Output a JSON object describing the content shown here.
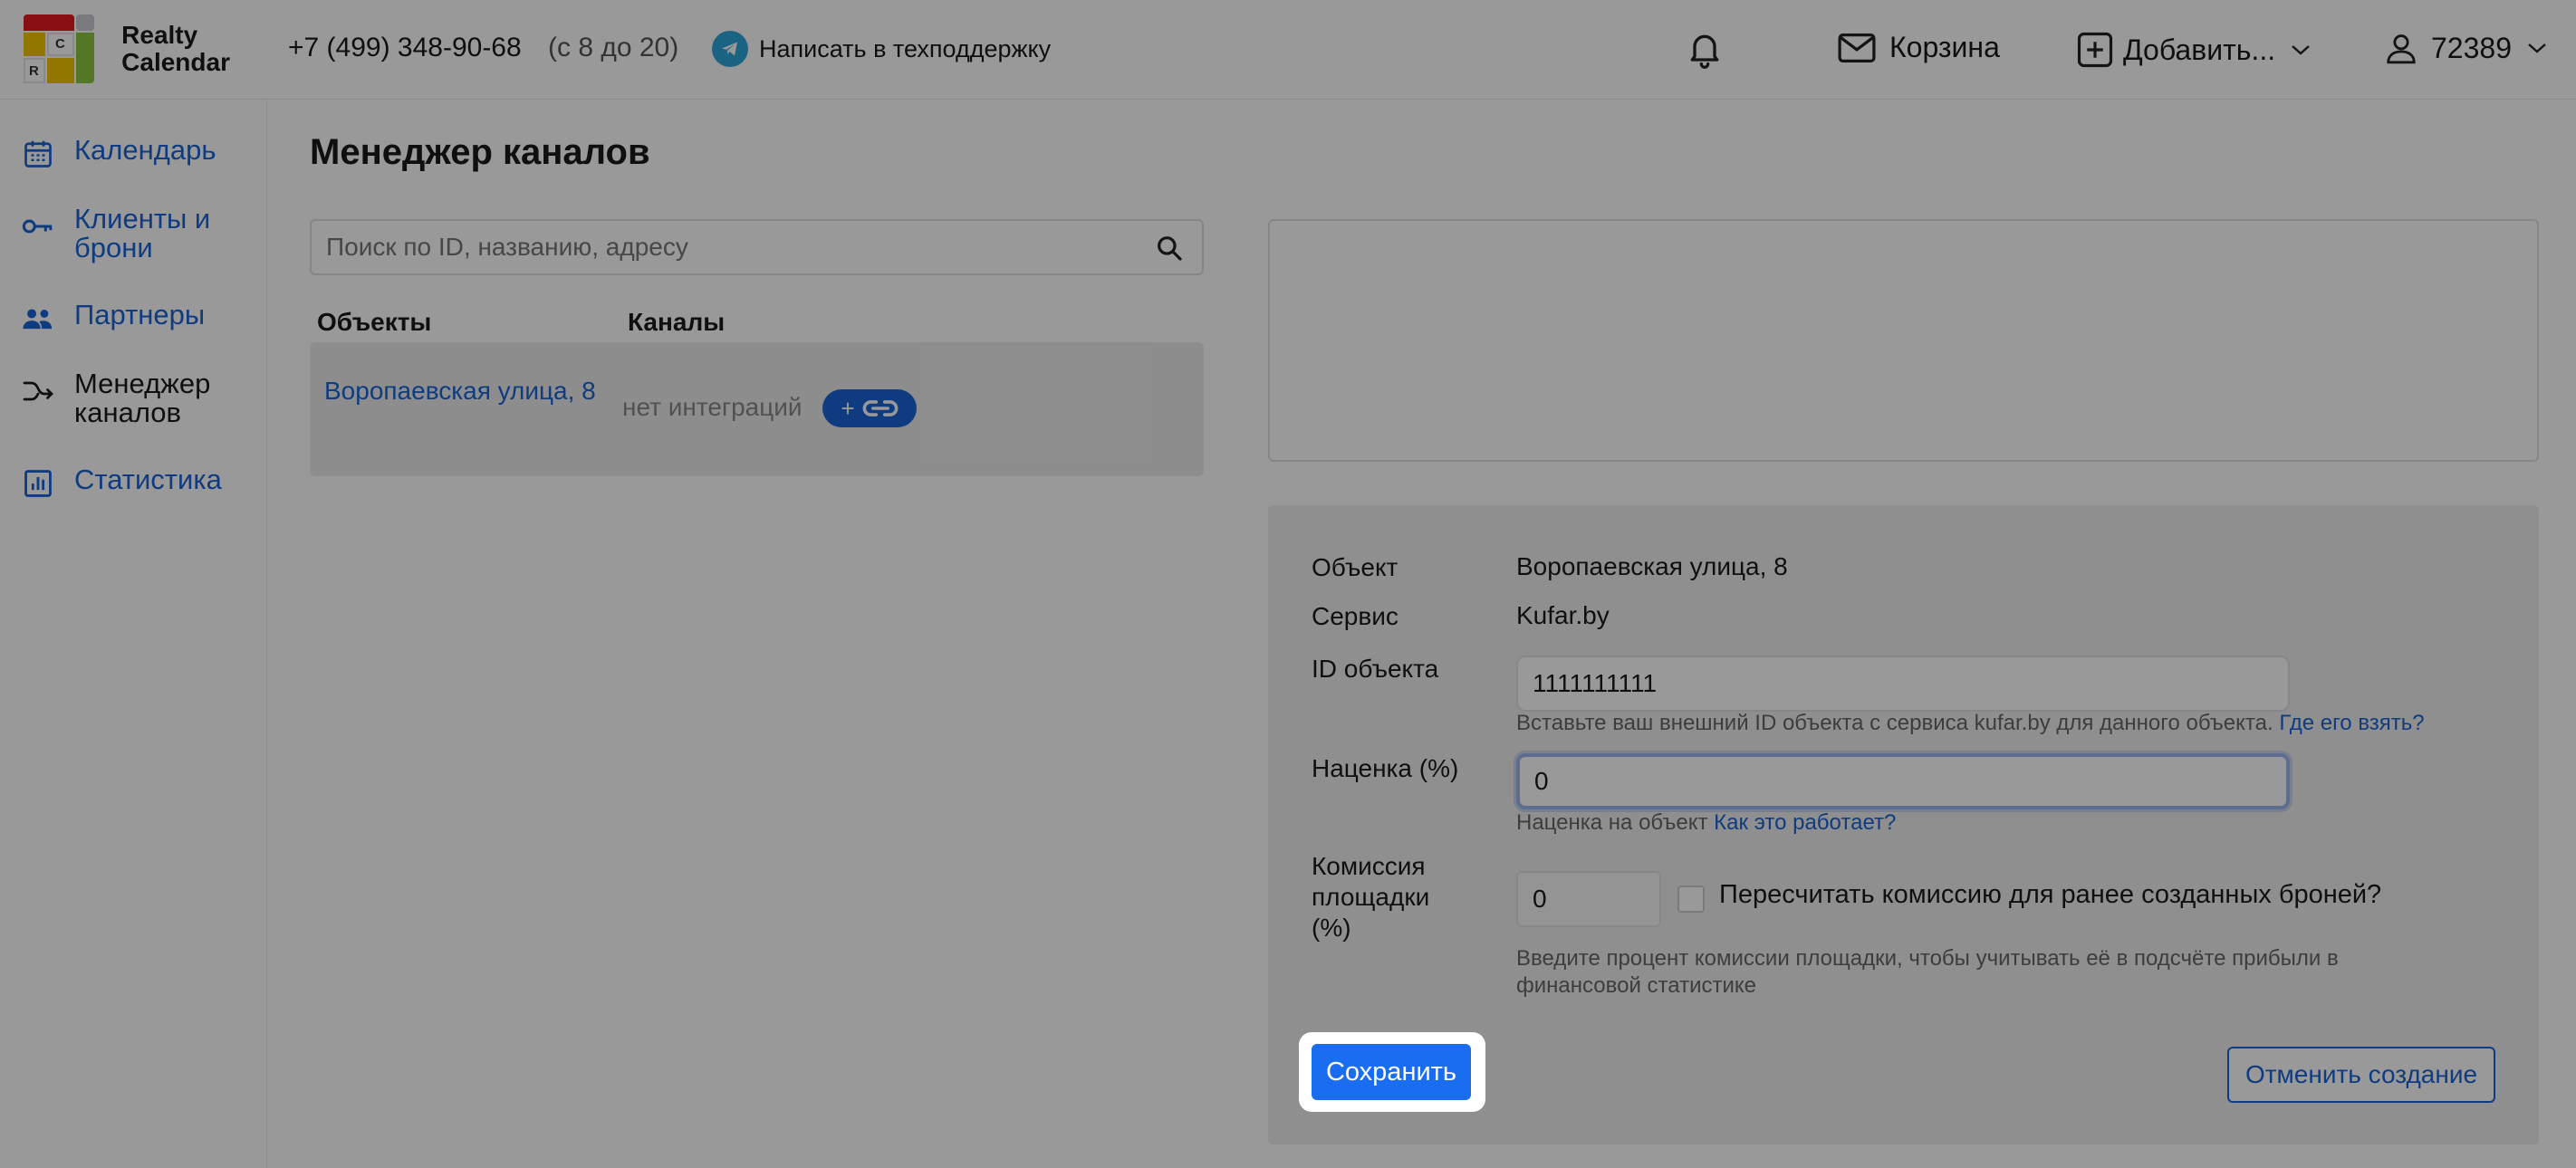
{
  "header": {
    "logo_text": "Realty Calendar",
    "logo_letters": {
      "c": "C",
      "r": "R"
    },
    "phone": "+7 (499) 348-90-68",
    "hours": "(с 8 до 20)",
    "support_label": "Написать в техподдержку",
    "cart_label": "Корзина",
    "add_label": "Добавить...",
    "user_id": "72389"
  },
  "sidebar": {
    "items": [
      {
        "label": "Календарь",
        "icon": "calendar-icon",
        "active": false
      },
      {
        "label": "Клиенты и брони",
        "icon": "key-icon",
        "active": false
      },
      {
        "label": "Партнеры",
        "icon": "people-icon",
        "active": false
      },
      {
        "label": "Менеджер каналов",
        "icon": "channels-icon",
        "active": true
      },
      {
        "label": "Статистика",
        "icon": "chart-icon",
        "active": false
      }
    ]
  },
  "main": {
    "title": "Менеджер каналов",
    "search_placeholder": "Поиск по ID, названию, адресу",
    "table_headers": {
      "objects": "Объекты",
      "channels": "Каналы"
    },
    "rows": [
      {
        "object": "Воропаевская улица, 8",
        "channels": "нет интеграций",
        "link_btn": "+"
      }
    ]
  },
  "form": {
    "object_label": "Объект",
    "object_value": "Воропаевская улица, 8",
    "service_label": "Сервис",
    "service_value": "Kufar.by",
    "id_label": "ID объекта",
    "id_value": "1111111111",
    "id_help": "Вставьте ваш внешний ID объекта с сервиса kufar.by для данного объекта.",
    "id_help_link": "Где его взять?",
    "markup_label": "Наценка (%)",
    "markup_value": "0",
    "markup_help": "Наценка на объект",
    "markup_help_link": "Как это работает?",
    "commission_label": "Комиссия площадки (%)",
    "commission_value": "0",
    "recalc_label": "Пересчитать комиссию для ранее созданных броней?",
    "commission_help": "Введите процент комиссии площадки, чтобы учитывать её в подсчёте прибыли в финансовой статистике",
    "save_label": "Сохранить",
    "cancel_label": "Отменить создание"
  },
  "colors": {
    "accent": "#1a63d6",
    "button": "#1a6cf0",
    "overlay": "rgba(0,0,0,0.4)"
  }
}
